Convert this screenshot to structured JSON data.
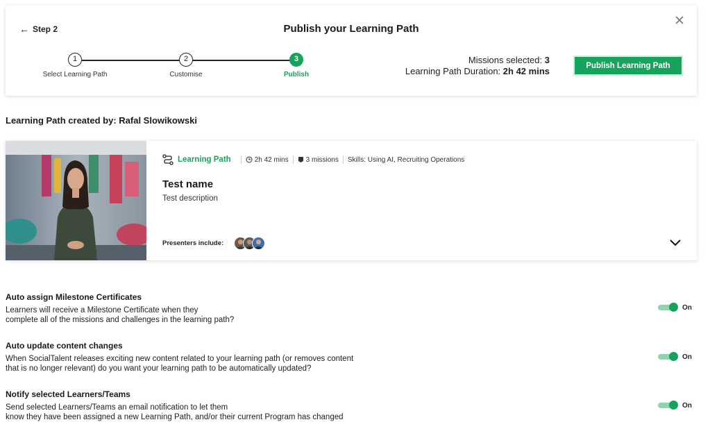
{
  "header": {
    "back_label": "Step 2",
    "title": "Publish your Learning Path",
    "steps": [
      {
        "number": "1",
        "label": "Select Learning Path"
      },
      {
        "number": "2",
        "label": "Customise"
      },
      {
        "number": "3",
        "label": "Publish"
      }
    ],
    "active_step": 3,
    "missions_label": "Missions selected:",
    "missions_value": "3",
    "duration_label": "Learning Path Duration:",
    "duration_value": "2h 42 mins",
    "publish_button": "Publish Learning Path"
  },
  "creator_line": "Learning Path created by: Rafal Slowikowski",
  "path_card": {
    "type": "Learning Path",
    "duration": "2h 42 mins",
    "missions": "3 missions",
    "skills": "Skills: Using AI, Recruiting Operations",
    "name": "Test name",
    "description": "Test description",
    "presenters_label": "Presenters include:",
    "presenter_count": 3
  },
  "settings": [
    {
      "title": "Auto assign Milestone Certificates",
      "description_lines": [
        "Learners will receive a Milestone Certificate when they",
        "complete all of the missions and challenges in the learning path?"
      ],
      "toggle_label": "On",
      "enabled": true
    },
    {
      "title": "Auto update content changes",
      "description_lines": [
        "When SocialTalent releases exciting new content related to your learning path (or removes content",
        "that is no longer relevant) do you want your learning path to be automatically updated?"
      ],
      "toggle_label": "On",
      "enabled": true
    },
    {
      "title": "Notify selected Learners/Teams",
      "description_lines": [
        "Send selected Learners/Teams an email notification to let them",
        "know they have been assigned a new Learning Path, and/or their current Program has changed"
      ],
      "toggle_label": "On",
      "enabled": true
    }
  ],
  "colors": {
    "accent": "#17a35b",
    "toggle_track": "#8fd4ad",
    "text": "#1a1a1a"
  }
}
